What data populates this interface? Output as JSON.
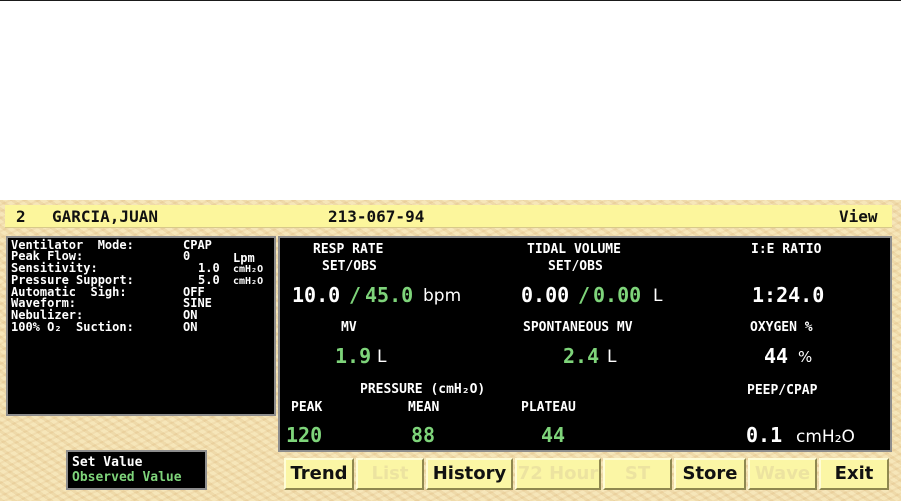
{
  "header": {
    "bed": "2",
    "patient": "GARCIA,JUAN",
    "id": "213-067-94",
    "view": "View"
  },
  "settings": {
    "mode_label": "Ventilator  Mode:",
    "mode_value": "CPAP",
    "peak_flow_label": "Peak Flow:",
    "peak_flow_value": "0",
    "peak_flow_unit": "Lpm",
    "sensitivity_label": "Sensitivity:",
    "sensitivity_value": "1.0",
    "sensitivity_unit": "cmH₂O",
    "pressure_support_label": "Pressure Support:",
    "pressure_support_value": "5.0",
    "pressure_support_unit": "cmH₂O",
    "sigh_label": "Automatic  Sigh:",
    "sigh_value": "OFF",
    "waveform_label": "Waveform:",
    "waveform_value": "SINE",
    "nebulizer_label": "Nebulizer:",
    "nebulizer_value": "ON",
    "suction_label": "100% O₂  Suction:",
    "suction_value": "ON"
  },
  "monitor": {
    "resp_rate_label": "RESP RATE",
    "resp_rate_sub": "SET/OBS",
    "resp_rate_set": "10.0",
    "resp_rate_obs": "45.0",
    "resp_rate_unit": "bpm",
    "tidal_label": "TIDAL VOLUME",
    "tidal_sub": "SET/OBS",
    "tidal_set": "0.00",
    "tidal_obs": "0.00",
    "tidal_unit": "L",
    "ie_label": "I:E RATIO",
    "ie_value": "1:24.0",
    "mv_label": "MV",
    "mv_value": "1.9",
    "mv_unit": "L",
    "spont_label": "SPONTANEOUS MV",
    "spont_value": "2.4",
    "spont_unit": "L",
    "oxygen_label": "OXYGEN %",
    "oxygen_value": "44",
    "oxygen_unit": "%",
    "pressure_label": "PRESSURE (cmH₂O)",
    "peak_label": "PEAK",
    "peak_value": "120",
    "mean_label": "MEAN",
    "mean_value": "88",
    "plateau_label": "PLATEAU",
    "plateau_value": "44",
    "peep_label": "PEEP/CPAP",
    "peep_value": "0.1",
    "peep_unit": "cmH₂O",
    "slash": "/"
  },
  "legend": {
    "set": "Set Value",
    "observed": "Observed Value"
  },
  "buttons": {
    "trend": "Trend",
    "list": "List",
    "history": "History",
    "hour72": "72 Hour",
    "st": "ST",
    "store": "Store",
    "wave": "Wave",
    "exit": "Exit"
  },
  "colors": {
    "observed": "#7ed47a",
    "set": "#ffffff",
    "header": "#fcf69c",
    "background": "#f4e2b2"
  }
}
